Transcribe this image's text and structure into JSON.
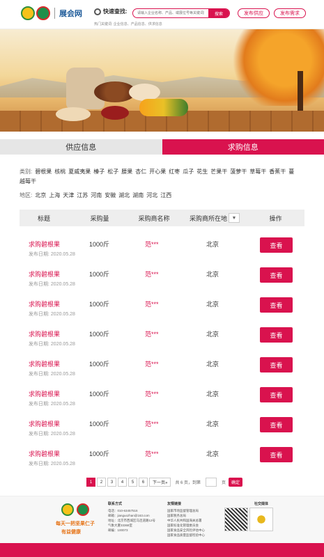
{
  "header": {
    "site_name": "展会网",
    "quick_search_label": "快速查找:",
    "search_placeholder": "请输入企业名称、产品、或展位号等关键词搜索",
    "search_button": "搜索",
    "hot_words": "热门关键词: 企业信息、产品信息、供求信息",
    "publish_supply": "发布供应",
    "publish_demand": "发布需求"
  },
  "tabs": {
    "supply": "供应信息",
    "demand": "求购信息"
  },
  "filters": {
    "category_label": "类别:",
    "categories": [
      "碧根果",
      "核桃",
      "夏威夷果",
      "榛子",
      "松子",
      "腰果",
      "杏仁",
      "开心果",
      "红枣",
      "瓜子",
      "花生",
      "芒果干",
      "菠萝干",
      "草莓干",
      "香蕉干",
      "蔓越莓干"
    ],
    "region_label": "地区:",
    "regions": [
      "北京",
      "上海",
      "天津",
      "江苏",
      "河南",
      "安徽",
      "湖北",
      "湖南",
      "河北",
      "江西"
    ]
  },
  "table": {
    "headers": {
      "title": "标题",
      "qty": "采购量",
      "buyer": "采购商名称",
      "location": "采购商所在地",
      "op": "操作"
    },
    "dropdown_icon": "▼",
    "date_prefix": "发布日期:",
    "view_label": "查看",
    "rows": [
      {
        "title": "求购碧根果",
        "date": "2020.05.28",
        "qty": "1000斤",
        "buyer": "范***",
        "location": "北京"
      },
      {
        "title": "求购碧根果",
        "date": "2020.05.28",
        "qty": "1000斤",
        "buyer": "范***",
        "location": "北京"
      },
      {
        "title": "求购碧根果",
        "date": "2020.05.28",
        "qty": "1000斤",
        "buyer": "范***",
        "location": "北京"
      },
      {
        "title": "求购碧根果",
        "date": "2020.05.28",
        "qty": "1000斤",
        "buyer": "范***",
        "location": "北京"
      },
      {
        "title": "求购碧根果",
        "date": "2020.05.28",
        "qty": "1000斤",
        "buyer": "范***",
        "location": "北京"
      },
      {
        "title": "求购碧根果",
        "date": "2020.05.28",
        "qty": "1000斤",
        "buyer": "范***",
        "location": "北京"
      },
      {
        "title": "求购碧根果",
        "date": "2020.05.28",
        "qty": "1000斤",
        "buyer": "范***",
        "location": "北京"
      },
      {
        "title": "求购碧根果",
        "date": "2020.05.28",
        "qty": "1000斤",
        "buyer": "范***",
        "location": "北京"
      }
    ]
  },
  "pagination": {
    "pages": [
      "1",
      "2",
      "3",
      "4",
      "5",
      "6"
    ],
    "current": "1",
    "next": "下一页»",
    "total": "共 6 页，到第",
    "page_unit": "页",
    "confirm": "确定"
  },
  "footer": {
    "slogan1": "每天一把坚果仁子",
    "slogan2": "有益健康",
    "contact_heading": "联系方式",
    "contact_lines": [
      "电话：010-63457516",
      "邮箱：jianguozhan@163.com",
      "地址：北京市西城区马连道路12号",
      "气象大厦33368室",
      "邮编：100073"
    ],
    "links_heading": "友情链接",
    "links": [
      "国家市场监督管理总局",
      "国家税务总局",
      "中华人民共和国海关总署",
      "国家标准化管理委员会",
      "国家食品安全风险评估中心",
      "国家食品质量监督检验中心"
    ],
    "social_heading": "社交媒体"
  },
  "colors": {
    "accent": "#d9124e"
  }
}
